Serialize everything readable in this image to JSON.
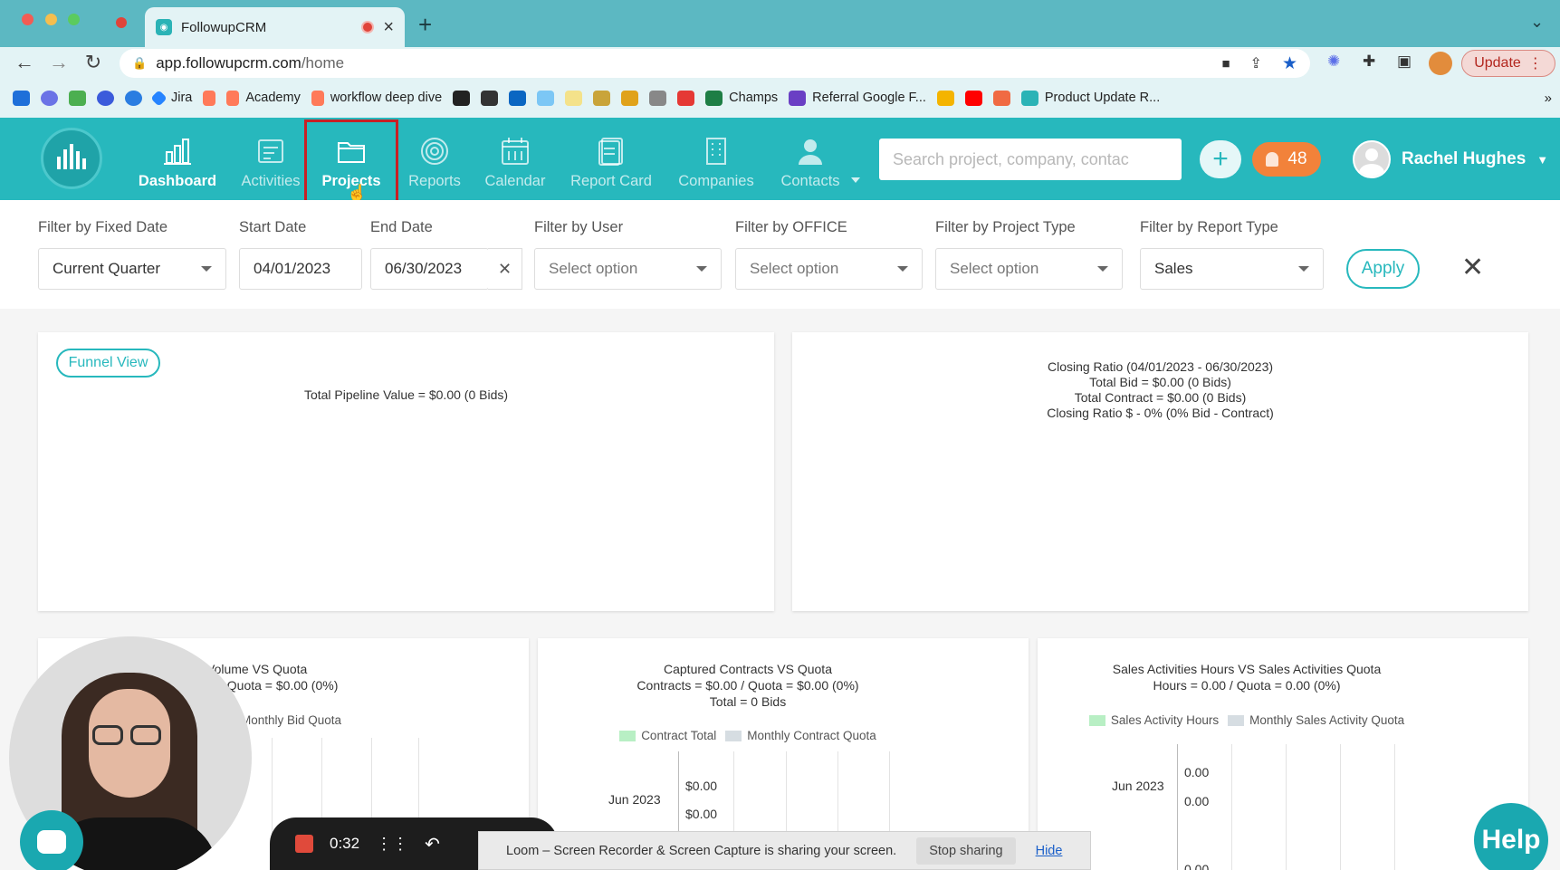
{
  "browser": {
    "tab_title": "FollowupCRM",
    "url_host": "app.followupcrm.com",
    "url_path": "/home",
    "update_label": "Update",
    "bookmarks": [
      "Jira",
      "Academy",
      "workflow deep dive",
      "Champs",
      "Referral Google F...",
      "Product Update R..."
    ]
  },
  "nav": {
    "items": [
      "Dashboard",
      "Activities",
      "Projects",
      "Reports",
      "Calendar",
      "Report Card",
      "Companies",
      "Contacts"
    ],
    "active": "Projects",
    "hovered": "Projects",
    "search_placeholder": "Search project, company, contac",
    "notification_count": "48",
    "user_name": "Rachel Hughes"
  },
  "filters": {
    "fixed_date_label": "Filter by Fixed Date",
    "fixed_date_value": "Current Quarter",
    "start_label": "Start Date",
    "start_value": "04/01/2023",
    "end_label": "End Date",
    "end_value": "06/30/2023",
    "user_label": "Filter by User",
    "user_value": "Select option",
    "office_label": "Filter by OFFICE",
    "office_value": "Select option",
    "project_type_label": "Filter by Project Type",
    "project_type_value": "Select option",
    "report_type_label": "Filter by Report Type",
    "report_type_value": "Sales",
    "apply_label": "Apply",
    "clear_icon": "close-icon"
  },
  "cards": {
    "funnel": {
      "button_label": "Funnel View",
      "total_text": "Total Pipeline Value = $0.00 (0 Bids)"
    },
    "closing": {
      "line1": "Closing Ratio (04/01/2023 - 06/30/2023)",
      "line2": "Total Bid = $0.00 (0 Bids)",
      "line3": "Total Contract = $0.00 (0 Bids)",
      "line4": "Closing Ratio $ - 0% (0% Bid - Contract)"
    },
    "bid_volume": {
      "title_partial": "Volume VS Quota",
      "sub_partial": "/ Quota = $0.00 (0%)",
      "legend_partial": "Monthly Bid Quota"
    },
    "contracts": {
      "title": "Captured Contracts VS Quota",
      "sub": "Contracts = $0.00 / Quota = $0.00 (0%)",
      "total": "Total = 0 Bids",
      "legend_a": "Contract Total",
      "legend_b": "Monthly Contract Quota",
      "y_label": "Jun 2023",
      "val_a": "$0.00",
      "val_b": "$0.00"
    },
    "activities": {
      "title": "Sales Activities Hours VS Sales Activities Quota",
      "sub": "Hours = 0.00 / Quota = 0.00 (0%)",
      "legend_a": "Sales Activity Hours",
      "legend_b": "Monthly Sales Activity Quota",
      "y_label": "Jun 2023",
      "val_a": "0.00",
      "val_b": "0.00",
      "val_c": "0.00"
    }
  },
  "overlay": {
    "timer": "0:32",
    "share_text": "Loom – Screen Recorder & Screen Capture is sharing your screen.",
    "stop_sharing": "Stop sharing",
    "hide": "Hide",
    "help": "Help"
  },
  "colors": {
    "teal": "#27b8bd",
    "orange": "#f2823a",
    "highlight": "#c81f25",
    "legend_green": "#b8efc4",
    "legend_gray": "#d6dde2"
  }
}
